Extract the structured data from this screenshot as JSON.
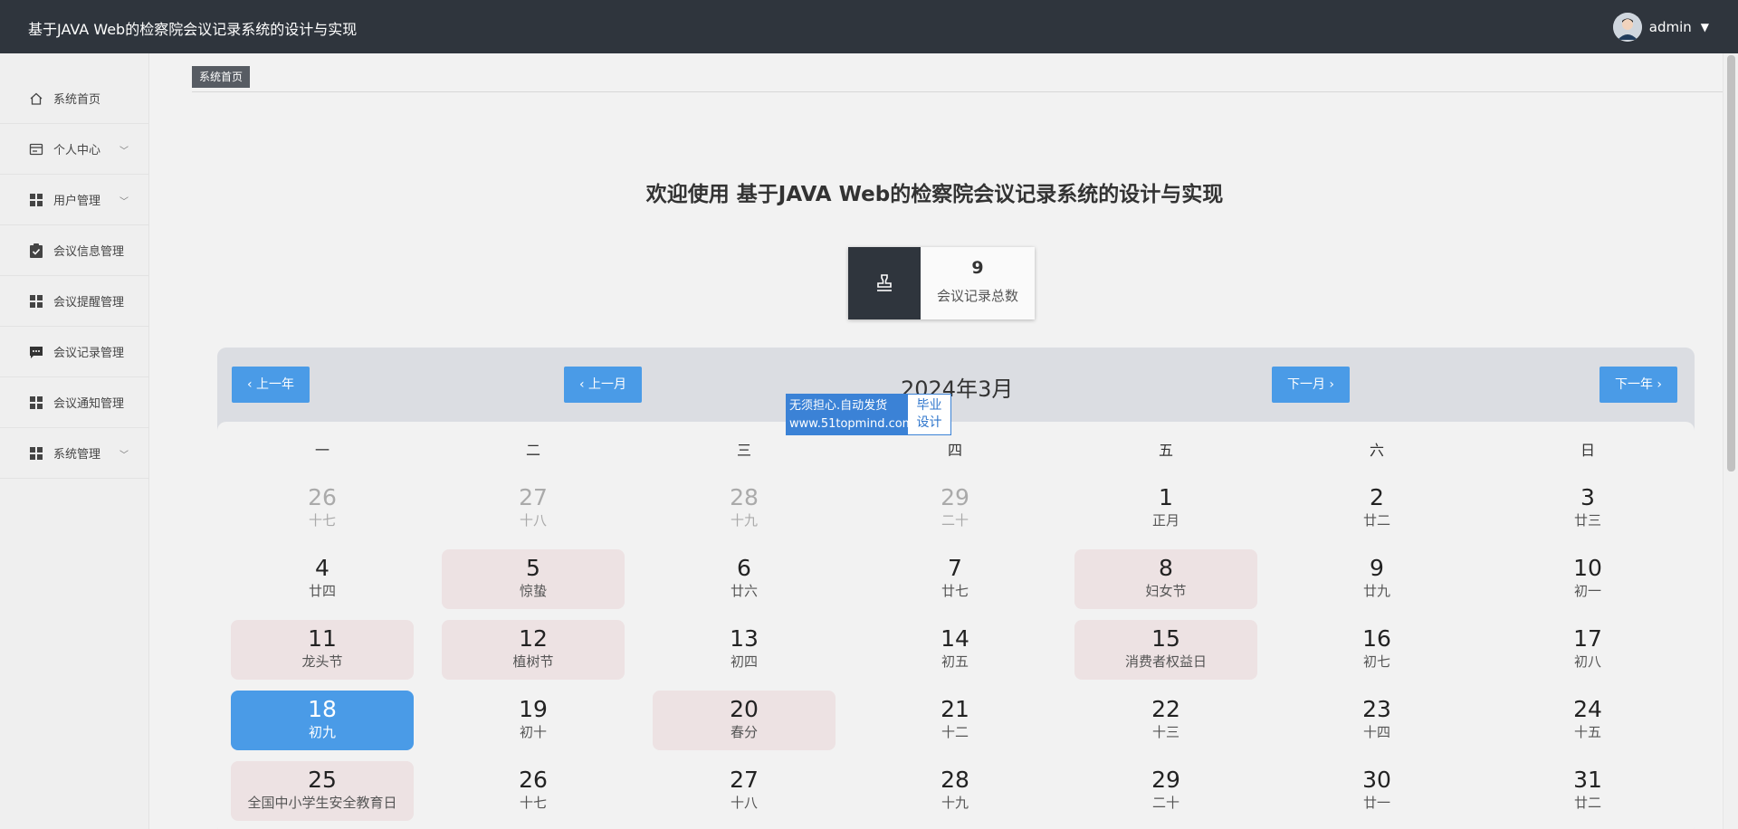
{
  "app": {
    "title": "基于JAVA Web的检察院会议记录系统的设计与实现",
    "user_name": "admin"
  },
  "sidebar": {
    "items": [
      {
        "label": "系统首页",
        "icon": "home-icon",
        "has_submenu": false
      },
      {
        "label": "个人中心",
        "icon": "profile-card-icon",
        "has_submenu": true
      },
      {
        "label": "用户管理",
        "icon": "grid-icon",
        "has_submenu": true
      },
      {
        "label": "会议信息管理",
        "icon": "clipboard-check-icon",
        "has_submenu": false
      },
      {
        "label": "会议提醒管理",
        "icon": "grid-icon",
        "has_submenu": false
      },
      {
        "label": "会议记录管理",
        "icon": "chat-bubble-icon",
        "has_submenu": false
      },
      {
        "label": "会议通知管理",
        "icon": "grid-icon",
        "has_submenu": false
      },
      {
        "label": "系统管理",
        "icon": "grid-icon",
        "has_submenu": true
      }
    ]
  },
  "breadcrumb": {
    "current": "系统首页"
  },
  "welcome": "欢迎使用 基于JAVA Web的检察院会议记录系统的设计与实现",
  "stats": {
    "meeting_records_total": "9",
    "meeting_records_label": "会议记录总数",
    "icon": "stamp-icon"
  },
  "calendar": {
    "title": "2024年3月",
    "prev_year": "上一年",
    "prev_month": "上一月",
    "next_month": "下一月",
    "next_year": "下一年",
    "weekdays": [
      "一",
      "二",
      "三",
      "四",
      "五",
      "六",
      "日"
    ],
    "weeks": [
      [
        {
          "d": "26",
          "l": "十七",
          "other": true
        },
        {
          "d": "27",
          "l": "十八",
          "other": true
        },
        {
          "d": "28",
          "l": "十九",
          "other": true
        },
        {
          "d": "29",
          "l": "二十",
          "other": true
        },
        {
          "d": "1",
          "l": "正月"
        },
        {
          "d": "2",
          "l": "廿二"
        },
        {
          "d": "3",
          "l": "廿三"
        }
      ],
      [
        {
          "d": "4",
          "l": "廿四"
        },
        {
          "d": "5",
          "l": "惊蛰",
          "festival": true
        },
        {
          "d": "6",
          "l": "廿六"
        },
        {
          "d": "7",
          "l": "廿七"
        },
        {
          "d": "8",
          "l": "妇女节",
          "festival": true
        },
        {
          "d": "9",
          "l": "廿九"
        },
        {
          "d": "10",
          "l": "初一"
        }
      ],
      [
        {
          "d": "11",
          "l": "龙头节",
          "festival": true
        },
        {
          "d": "12",
          "l": "植树节",
          "festival": true
        },
        {
          "d": "13",
          "l": "初四"
        },
        {
          "d": "14",
          "l": "初五"
        },
        {
          "d": "15",
          "l": "消费者权益日",
          "festival": true
        },
        {
          "d": "16",
          "l": "初七"
        },
        {
          "d": "17",
          "l": "初八"
        }
      ],
      [
        {
          "d": "18",
          "l": "初九",
          "today": true
        },
        {
          "d": "19",
          "l": "初十"
        },
        {
          "d": "20",
          "l": "春分",
          "festival": true
        },
        {
          "d": "21",
          "l": "十二"
        },
        {
          "d": "22",
          "l": "十三"
        },
        {
          "d": "23",
          "l": "十四"
        },
        {
          "d": "24",
          "l": "十五"
        }
      ],
      [
        {
          "d": "25",
          "l": "全国中小学生安全教育日",
          "festival": true
        },
        {
          "d": "26",
          "l": "十七"
        },
        {
          "d": "27",
          "l": "十八"
        },
        {
          "d": "28",
          "l": "十九"
        },
        {
          "d": "29",
          "l": "二十"
        },
        {
          "d": "30",
          "l": "廿一"
        },
        {
          "d": "31",
          "l": "廿二"
        }
      ]
    ]
  },
  "watermark": {
    "line1": "无须担心.自动发货",
    "line2": "www.51topmind.com",
    "right1": "毕业",
    "right2": "设计"
  },
  "colors": {
    "topbar": "#2f353d",
    "accent": "#4a9be7",
    "festival_bg": "#ede2e3"
  }
}
